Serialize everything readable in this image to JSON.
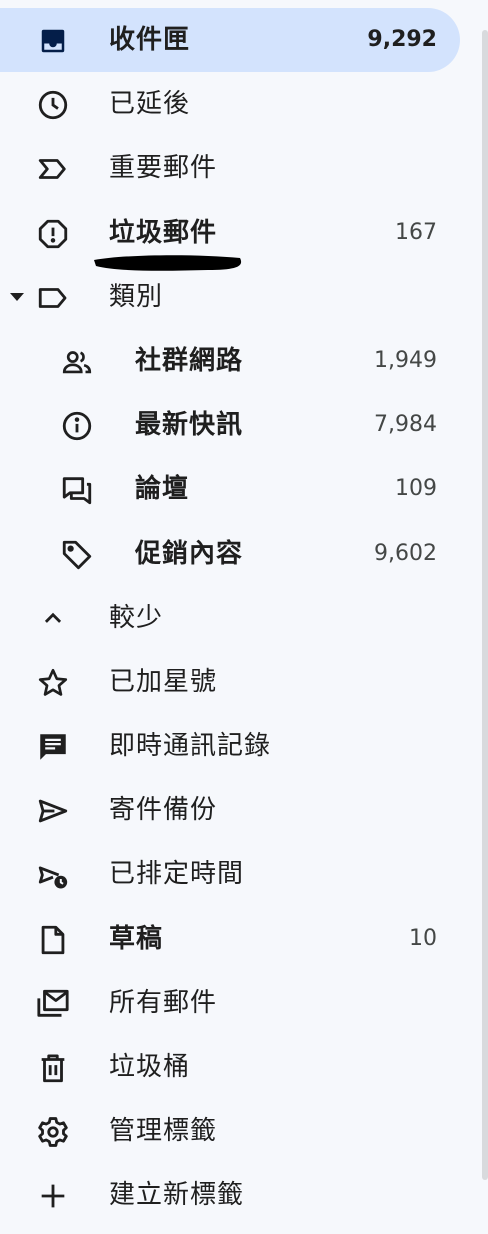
{
  "colors": {
    "selected_bg": "#d3e3fd",
    "page_bg": "#f6f8fc",
    "text": "#1f1f1f",
    "count": "#444746"
  },
  "nav": {
    "inbox": {
      "label": "收件匣",
      "count": "9,292",
      "icon": "inbox-icon"
    },
    "snoozed": {
      "label": "已延後",
      "icon": "clock-icon"
    },
    "important": {
      "label": "重要郵件",
      "icon": "label-important-icon"
    },
    "spam": {
      "label": "垃圾郵件",
      "count": "167",
      "icon": "report-icon"
    },
    "categories": {
      "label": "類別",
      "icon": "label-outline-icon"
    },
    "social": {
      "label": "社群網路",
      "count": "1,949",
      "icon": "people-icon"
    },
    "updates": {
      "label": "最新快訊",
      "count": "7,984",
      "icon": "info-icon"
    },
    "forums": {
      "label": "論壇",
      "count": "109",
      "icon": "forum-icon"
    },
    "promotions": {
      "label": "促銷內容",
      "count": "9,602",
      "icon": "tag-icon"
    },
    "less": {
      "label": "較少",
      "icon": "chevron-up-icon"
    },
    "starred": {
      "label": "已加星號",
      "icon": "star-icon"
    },
    "chats": {
      "label": "即時通訊記錄",
      "icon": "chat-icon"
    },
    "sent": {
      "label": "寄件備份",
      "icon": "send-icon"
    },
    "scheduled": {
      "label": "已排定時間",
      "icon": "schedule-send-icon"
    },
    "drafts": {
      "label": "草稿",
      "count": "10",
      "icon": "draft-icon"
    },
    "all_mail": {
      "label": "所有郵件",
      "icon": "all-mail-icon"
    },
    "trash": {
      "label": "垃圾桶",
      "icon": "trash-icon"
    },
    "manage_labels": {
      "label": "管理標籤",
      "icon": "gear-icon"
    },
    "create_label": {
      "label": "建立新標籤",
      "icon": "plus-icon"
    }
  }
}
